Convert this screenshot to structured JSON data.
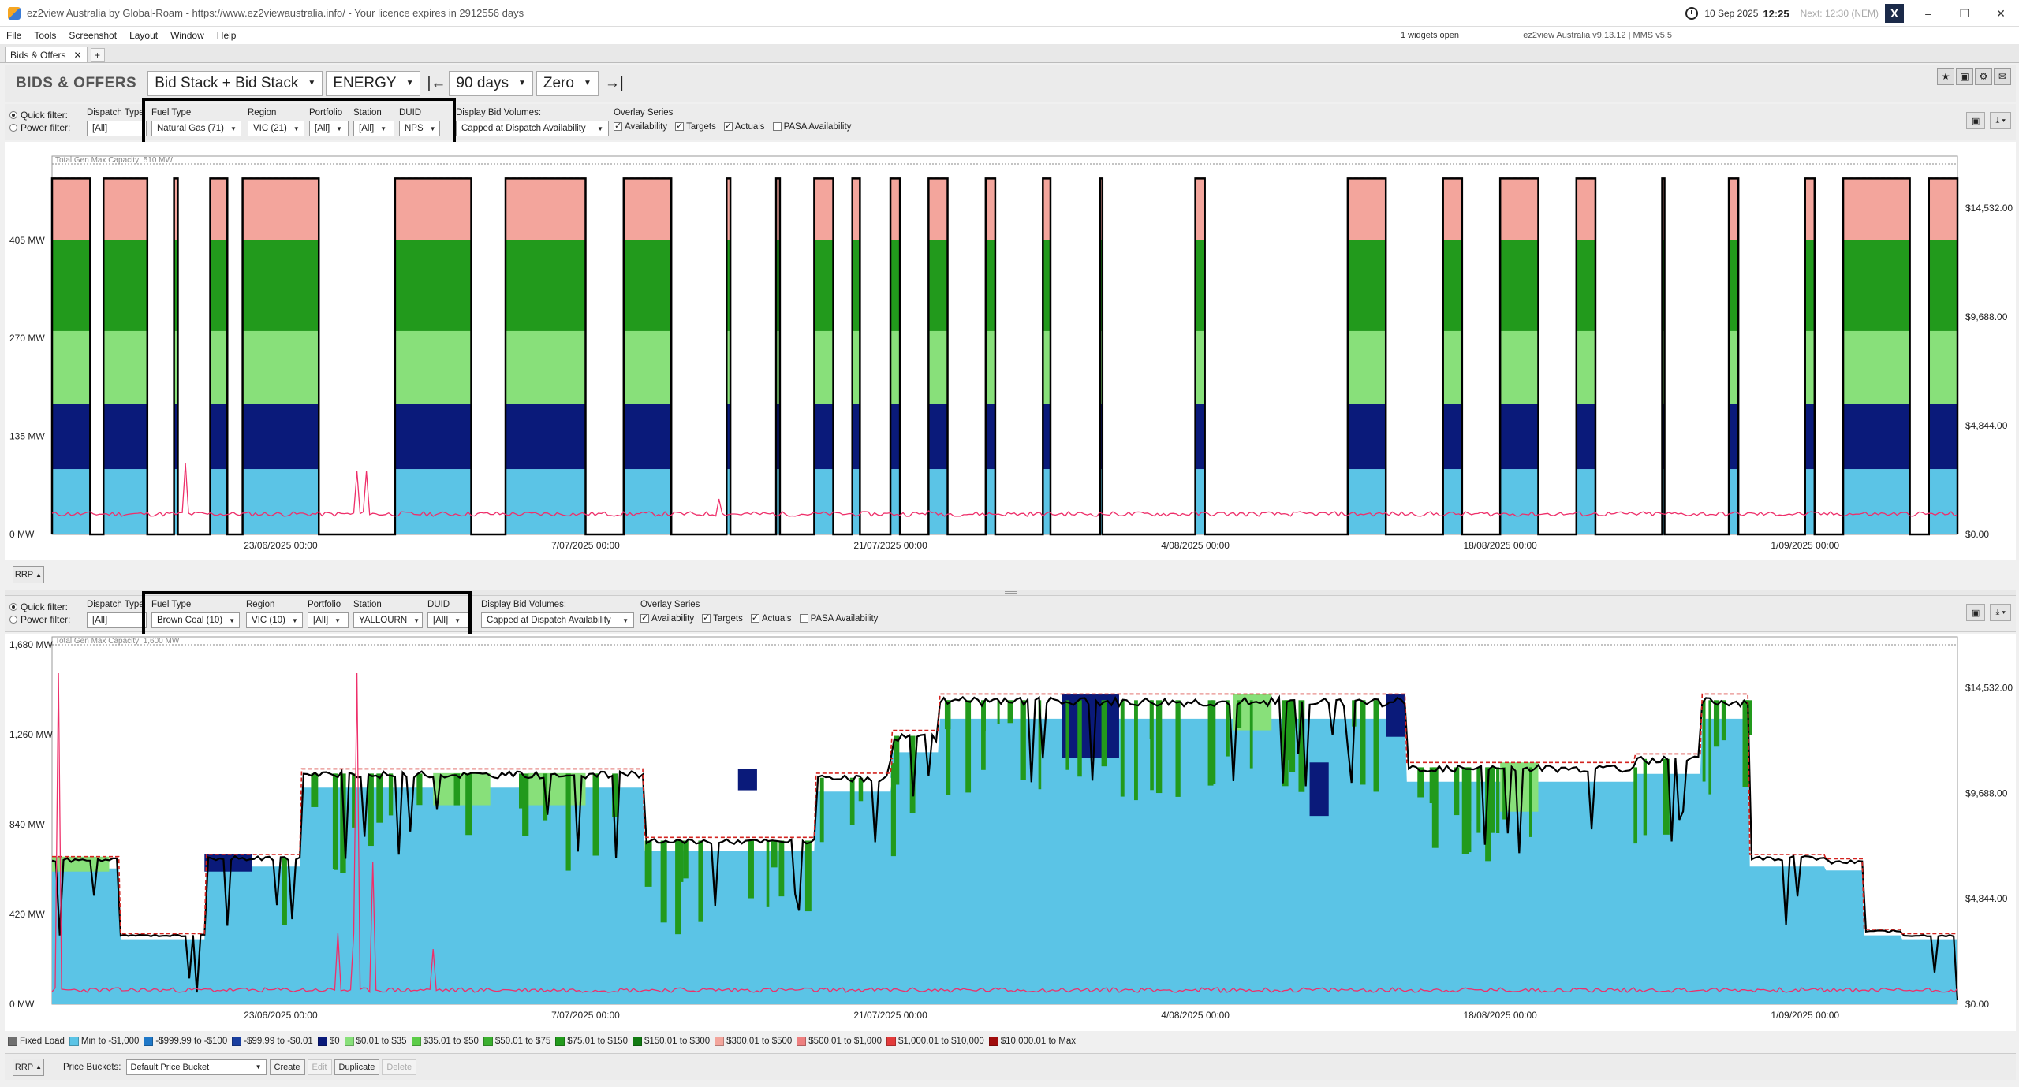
{
  "window": {
    "title": "ez2view Australia by Global-Roam - https://www.ez2viewaustralia.info/ - Your licence expires in 2912556 days",
    "date": "10 Sep 2025",
    "time": "12:25",
    "next": "Next: 12:30 (NEM)",
    "widgets_open": "1 widgets open",
    "version": "ez2view Australia v9.13.12 | MMS v5.5",
    "minimize": "–",
    "maximize": "❐",
    "close": "✕",
    "x_badge": "X"
  },
  "menu": [
    "File",
    "Tools",
    "Screenshot",
    "Layout",
    "Window",
    "Help"
  ],
  "tabs": [
    {
      "label": "Bids & Offers",
      "close": "✕"
    }
  ],
  "tab_add": "+",
  "toolbar": {
    "title": "BIDS & OFFERS",
    "view_mode": "Bid Stack + Bid Stack",
    "market": "ENERGY",
    "period": "90 days",
    "baseline": "Zero",
    "first_arrow": "|←",
    "last_arrow": "→|"
  },
  "panels": [
    {
      "radio_quick": "Quick filter:",
      "radio_power": "Power filter:",
      "dispatch_type_label": "Dispatch Type",
      "dispatch_type_value": "[All]",
      "fuel_type_label": "Fuel Type",
      "fuel_type_value": "Natural Gas (71)",
      "region_label": "Region",
      "region_value": "VIC (21)",
      "portfolio_label": "Portfolio",
      "portfolio_value": "[All]",
      "station_label": "Station",
      "station_value": "[All]",
      "duid_label": "DUID",
      "duid_value": "NPS",
      "display_bid_volumes_label": "Display Bid Volumes:",
      "display_bid_volumes_value": "Capped at Dispatch Availability",
      "overlay_label": "Overlay Series",
      "overlay_items": [
        {
          "label": "Availability",
          "checked": true
        },
        {
          "label": "Targets",
          "checked": true
        },
        {
          "label": "Actuals",
          "checked": true
        },
        {
          "label": "PASA Availability",
          "checked": false
        }
      ],
      "capacity_label": "Total Gen Max Capacity: 510 MW",
      "rrp_button": "RRP"
    },
    {
      "radio_quick": "Quick filter:",
      "radio_power": "Power filter:",
      "dispatch_type_label": "Dispatch Type",
      "dispatch_type_value": "[All]",
      "fuel_type_label": "Fuel Type",
      "fuel_type_value": "Brown Coal (10)",
      "region_label": "Region",
      "region_value": "VIC (10)",
      "portfolio_label": "Portfolio",
      "portfolio_value": "[All]",
      "station_label": "Station",
      "station_value": "YALLOURN",
      "duid_label": "DUID",
      "duid_value": "[All]",
      "display_bid_volumes_label": "Display Bid Volumes:",
      "display_bid_volumes_value": "Capped at Dispatch Availability",
      "overlay_label": "Overlay Series",
      "overlay_items": [
        {
          "label": "Availability",
          "checked": true
        },
        {
          "label": "Targets",
          "checked": true
        },
        {
          "label": "Actuals",
          "checked": true
        },
        {
          "label": "PASA Availability",
          "checked": false
        }
      ],
      "capacity_label": "Total Gen Max Capacity: 1,600 MW",
      "rrp_button": "RRP"
    }
  ],
  "chart_data": [
    {
      "type": "area",
      "title": "",
      "x_ticks": [
        "23/06/2025 00:00",
        "7/07/2025 00:00",
        "21/07/2025 00:00",
        "4/08/2025 00:00",
        "18/08/2025 00:00",
        "1/09/2025 00:00"
      ],
      "y_ticks": [
        "0 MW",
        "135 MW",
        "270 MW",
        "405 MW"
      ],
      "y2_ticks": [
        "$0.00",
        "$4,844.00",
        "$9,688.00",
        "$14,532.00"
      ],
      "ylim": [
        0,
        510
      ],
      "online_periods": [
        [
          0.0,
          0.02
        ],
        [
          0.027,
          0.05
        ],
        [
          0.064,
          0.066
        ],
        [
          0.083,
          0.092
        ],
        [
          0.1,
          0.14
        ],
        [
          0.18,
          0.22
        ],
        [
          0.238,
          0.28
        ],
        [
          0.3,
          0.325
        ],
        [
          0.354,
          0.356
        ],
        [
          0.38,
          0.382
        ],
        [
          0.4,
          0.41
        ],
        [
          0.42,
          0.424
        ],
        [
          0.44,
          0.445
        ],
        [
          0.46,
          0.47
        ],
        [
          0.49,
          0.495
        ],
        [
          0.52,
          0.524
        ],
        [
          0.55,
          0.551
        ],
        [
          0.6,
          0.605
        ],
        [
          0.68,
          0.7
        ],
        [
          0.73,
          0.74
        ],
        [
          0.76,
          0.78
        ],
        [
          0.8,
          0.81
        ],
        [
          0.845,
          0.846
        ],
        [
          0.88,
          0.885
        ],
        [
          0.92,
          0.925
        ],
        [
          0.94,
          0.975
        ],
        [
          0.985,
          1.0
        ]
      ],
      "online_level_mw": 490,
      "price_band_order": [
        "Min to -$1,000",
        "$0",
        "$0.01 to $35",
        "$75.01 to $150",
        "$300.01 to $500"
      ]
    },
    {
      "type": "area",
      "title": "",
      "x_ticks": [
        "23/06/2025 00:00",
        "7/07/2025 00:00",
        "21/07/2025 00:00",
        "4/08/2025 00:00",
        "18/08/2025 00:00",
        "1/09/2025 00:00"
      ],
      "y_ticks": [
        "0 MW",
        "420 MW",
        "840 MW",
        "1,260 MW",
        "1,680 MW"
      ],
      "y2_ticks": [
        "$0.00",
        "$4,844.00",
        "$9,688.00",
        "$14,532.00"
      ],
      "ylim": [
        0,
        1680
      ],
      "availability_steps": [
        [
          0.0,
          690
        ],
        [
          0.035,
          690
        ],
        [
          0.036,
          330
        ],
        [
          0.08,
          330
        ],
        [
          0.081,
          700
        ],
        [
          0.13,
          700
        ],
        [
          0.131,
          1100
        ],
        [
          0.31,
          1100
        ],
        [
          0.311,
          780
        ],
        [
          0.4,
          780
        ],
        [
          0.401,
          1080
        ],
        [
          0.44,
          1080
        ],
        [
          0.441,
          1150
        ],
        [
          0.44,
          1150
        ],
        [
          0.441,
          1280
        ],
        [
          0.465,
          1280
        ],
        [
          0.466,
          1450
        ],
        [
          0.71,
          1450
        ],
        [
          0.711,
          1130
        ],
        [
          0.83,
          1130
        ],
        [
          0.831,
          1170
        ],
        [
          0.865,
          1170
        ],
        [
          0.866,
          1450
        ],
        [
          0.89,
          1450
        ],
        [
          0.891,
          700
        ],
        [
          0.93,
          700
        ],
        [
          0.931,
          680
        ],
        [
          0.95,
          680
        ],
        [
          0.951,
          350
        ],
        [
          0.97,
          350
        ],
        [
          0.971,
          330
        ],
        [
          1.0,
          330
        ]
      ],
      "price_band_order": [
        "Min to -$1,000",
        "$0",
        "$0.01 to $35",
        "$75.01 to $150"
      ]
    }
  ],
  "legend": [
    {
      "label": "Fixed Load",
      "color": "#707070"
    },
    {
      "label": "Min to -$1,000",
      "color": "#5bc4e6"
    },
    {
      "label": "-$999.99 to -$100",
      "color": "#1f78c8"
    },
    {
      "label": "-$99.99 to -$0.01",
      "color": "#1a3fa0"
    },
    {
      "label": "$0",
      "color": "#0a1a7a"
    },
    {
      "label": "$0.01 to $35",
      "color": "#88e07a"
    },
    {
      "label": "$35.01 to $50",
      "color": "#5ccc48"
    },
    {
      "label": "$50.01 to $75",
      "color": "#3cb030"
    },
    {
      "label": "$75.01 to $150",
      "color": "#229a1c"
    },
    {
      "label": "$150.01 to $300",
      "color": "#127a12"
    },
    {
      "label": "$300.01 to $500",
      "color": "#f3a59c"
    },
    {
      "label": "$500.01 to $1,000",
      "color": "#ee7f7f"
    },
    {
      "label": "$1,000.01 to $10,000",
      "color": "#e33b3b"
    },
    {
      "label": "$10,000.01 to Max",
      "color": "#a00c0c"
    }
  ],
  "bottom": {
    "rrp": "RRP",
    "price_buckets_label": "Price Buckets:",
    "price_bucket_value": "Default Price Bucket",
    "create": "Create",
    "edit": "Edit",
    "duplicate": "Duplicate",
    "delete": "Delete"
  },
  "colors": {
    "rrp_line": "#ee2f6a",
    "availability_line": "#d3231f",
    "actuals_line": "#000000"
  }
}
